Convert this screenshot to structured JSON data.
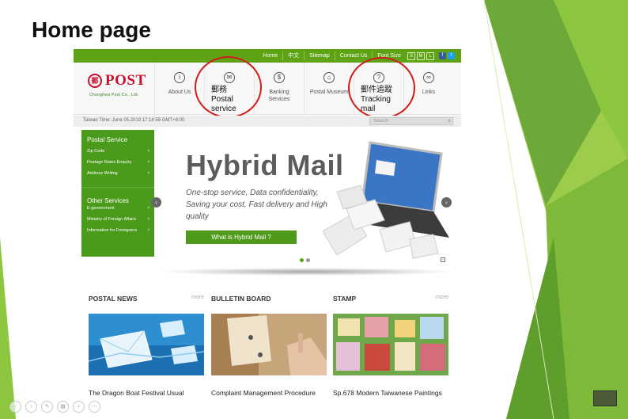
{
  "slide": {
    "title": "Home page"
  },
  "site": {
    "topbar": {
      "links": [
        "Home",
        "中文",
        "Sitemap",
        "Contact Us",
        "Font Size"
      ],
      "font_sizes": [
        "S",
        "M",
        "L"
      ],
      "social": [
        "f",
        "t"
      ]
    },
    "logo": {
      "mark": "郵",
      "text": "POST",
      "sub": "Chunghwa Post Co., Ltd."
    },
    "nav": [
      {
        "label": "About Us",
        "icon": "info-icon",
        "glyph": "i"
      },
      {
        "label": "郵務\nPostal service",
        "icon": "envelope-icon",
        "glyph": "✉"
      },
      {
        "label": "Banking\nServices",
        "icon": "dollar-icon",
        "glyph": "$"
      },
      {
        "label": "Postal Museum",
        "icon": "museum-icon",
        "glyph": "⌂"
      },
      {
        "label": "郵件追蹤\nTracking mail",
        "icon": "question-icon",
        "glyph": "?"
      },
      {
        "label": "Links",
        "icon": "link-icon",
        "glyph": "∞"
      }
    ],
    "time": "Taiwan Time: June 05,2019 17:14:58 GMT+8:00",
    "search": {
      "placeholder": "Search",
      "icon": "search-icon"
    },
    "sidebar": {
      "postal_heading": "Postal Service",
      "postal_items": [
        "Zip Code",
        "Postage Rates Enquiry",
        "Address Writing"
      ],
      "other_heading": "Other Services",
      "other_items": [
        "E-government",
        "Ministry of Foreign Affairs",
        "Information for Foreigners"
      ]
    },
    "hero": {
      "title": "Hybrid Mail",
      "description": "One-stop service, Data confidentiality, Saving your cost, Fast delivery and High quality",
      "button": "What is Hybrid Mail ?",
      "prev": "‹",
      "next": "›"
    },
    "sections": [
      {
        "title": "POSTAL NEWS",
        "more": "more",
        "caption": "The Dragon Boat Festival Usual"
      },
      {
        "title": "BULLETIN BOARD",
        "more": "",
        "caption": "Complaint Management Procedure"
      },
      {
        "title": "STAMP",
        "more": "more",
        "caption": "Sp.678 Modern Taiwanese Paintings"
      }
    ]
  },
  "colors": {
    "brand_green": "#5ea313",
    "logo_red": "#c8102e",
    "annotation_red": "#d11b1b"
  }
}
